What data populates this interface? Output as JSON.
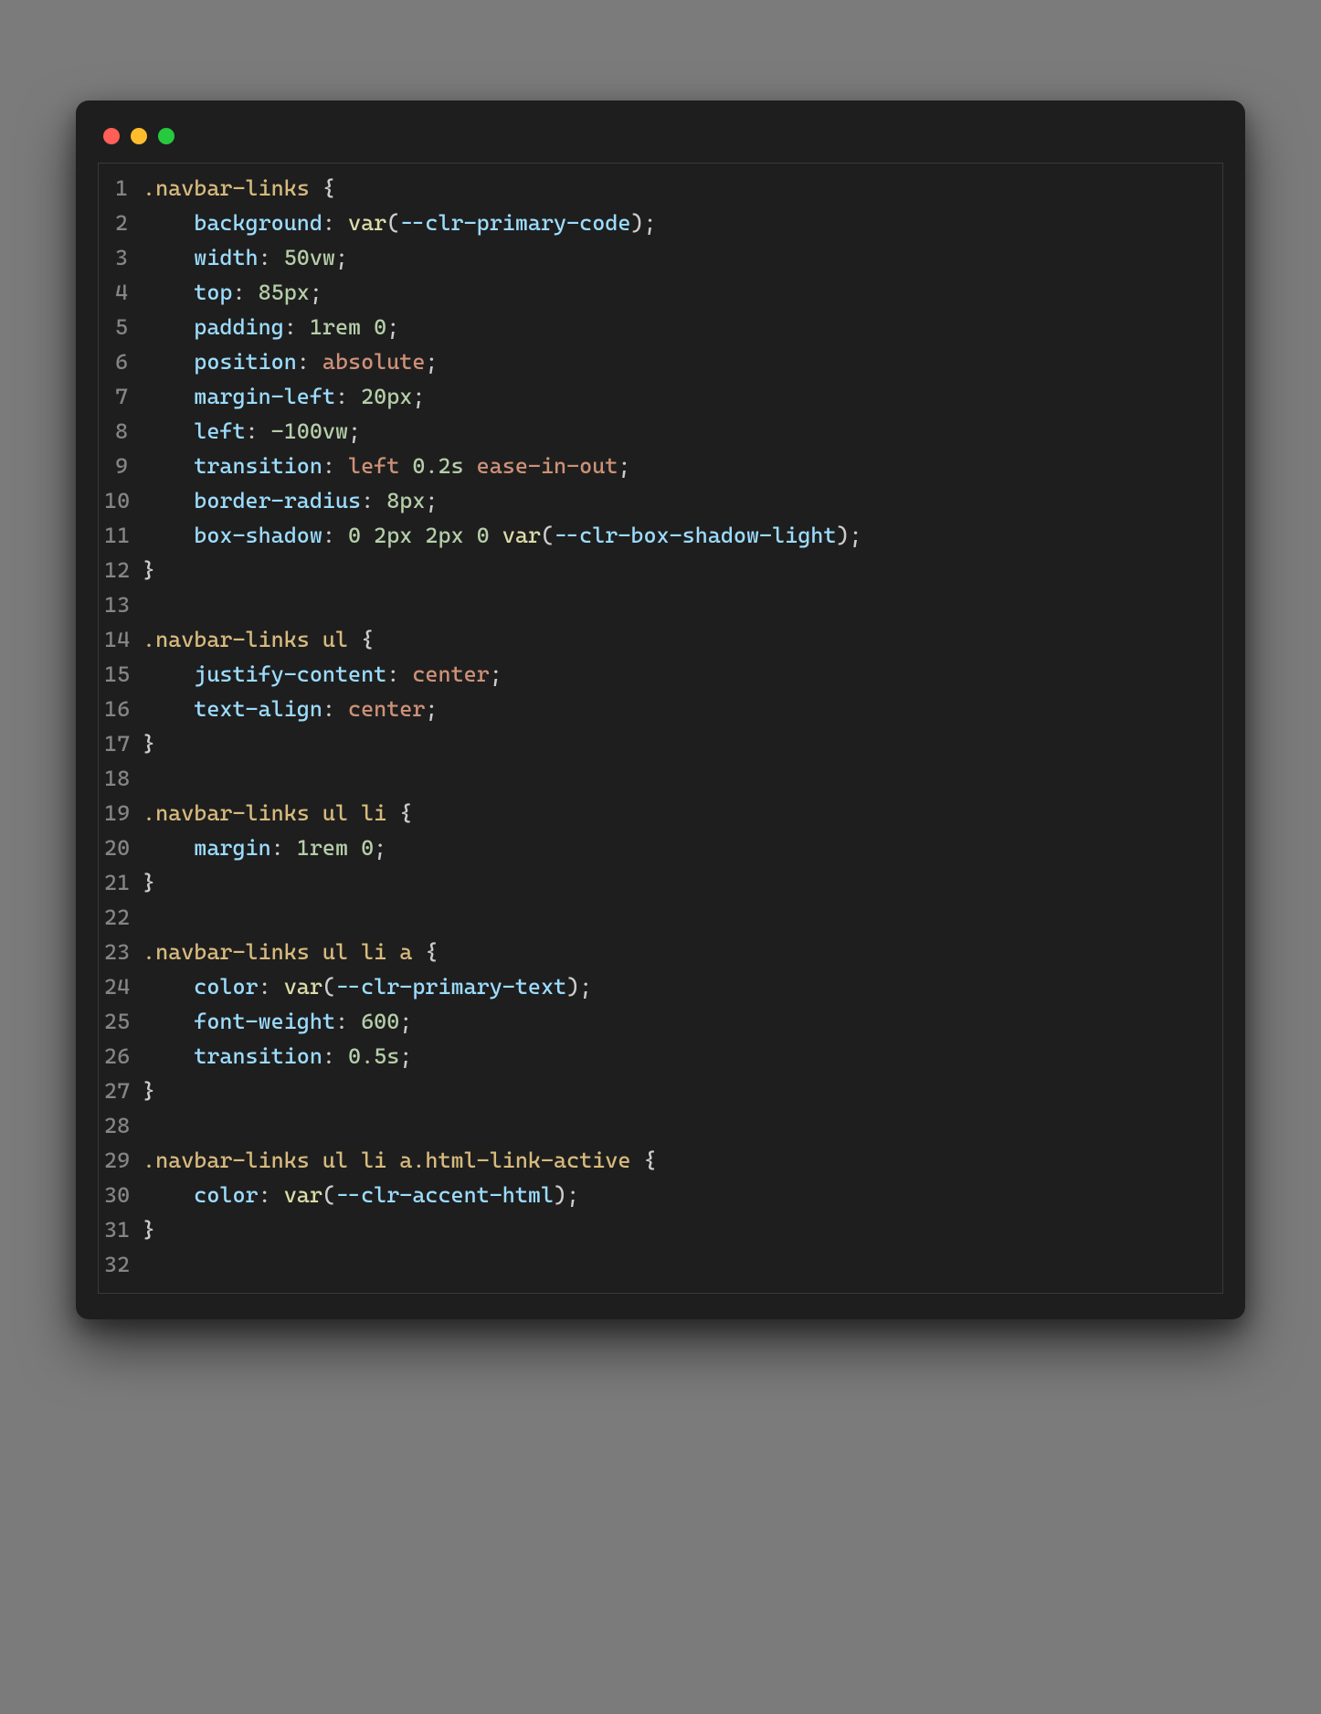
{
  "window": {
    "traffic_lights": [
      "close",
      "minimize",
      "zoom"
    ]
  },
  "code": {
    "language": "css",
    "lines": [
      {
        "n": 1,
        "indent": 0,
        "tokens": [
          {
            "t": ".navbar-links",
            "c": "sel"
          },
          {
            "t": " ",
            "c": "punct"
          },
          {
            "t": "{",
            "c": "brace"
          }
        ]
      },
      {
        "n": 2,
        "indent": 1,
        "tokens": [
          {
            "t": "background",
            "c": "prop"
          },
          {
            "t": ": ",
            "c": "punct"
          },
          {
            "t": "var",
            "c": "func"
          },
          {
            "t": "(",
            "c": "punct"
          },
          {
            "t": "--clr-primary-code",
            "c": "prop"
          },
          {
            "t": ")",
            "c": "punct"
          },
          {
            "t": ";",
            "c": "punct"
          }
        ]
      },
      {
        "n": 3,
        "indent": 1,
        "tokens": [
          {
            "t": "width",
            "c": "prop"
          },
          {
            "t": ": ",
            "c": "punct"
          },
          {
            "t": "50vw",
            "c": "num"
          },
          {
            "t": ";",
            "c": "punct"
          }
        ]
      },
      {
        "n": 4,
        "indent": 1,
        "tokens": [
          {
            "t": "top",
            "c": "prop"
          },
          {
            "t": ": ",
            "c": "punct"
          },
          {
            "t": "85px",
            "c": "num"
          },
          {
            "t": ";",
            "c": "punct"
          }
        ]
      },
      {
        "n": 5,
        "indent": 1,
        "tokens": [
          {
            "t": "padding",
            "c": "prop"
          },
          {
            "t": ": ",
            "c": "punct"
          },
          {
            "t": "1rem",
            "c": "num"
          },
          {
            "t": " ",
            "c": "punct"
          },
          {
            "t": "0",
            "c": "num"
          },
          {
            "t": ";",
            "c": "punct"
          }
        ]
      },
      {
        "n": 6,
        "indent": 1,
        "tokens": [
          {
            "t": "position",
            "c": "prop"
          },
          {
            "t": ": ",
            "c": "punct"
          },
          {
            "t": "absolute",
            "c": "str"
          },
          {
            "t": ";",
            "c": "punct"
          }
        ]
      },
      {
        "n": 7,
        "indent": 1,
        "tokens": [
          {
            "t": "margin-left",
            "c": "prop"
          },
          {
            "t": ": ",
            "c": "punct"
          },
          {
            "t": "20px",
            "c": "num"
          },
          {
            "t": ";",
            "c": "punct"
          }
        ]
      },
      {
        "n": 8,
        "indent": 1,
        "tokens": [
          {
            "t": "left",
            "c": "prop"
          },
          {
            "t": ": ",
            "c": "punct"
          },
          {
            "t": "-100vw",
            "c": "num"
          },
          {
            "t": ";",
            "c": "punct"
          }
        ]
      },
      {
        "n": 9,
        "indent": 1,
        "tokens": [
          {
            "t": "transition",
            "c": "prop"
          },
          {
            "t": ": ",
            "c": "punct"
          },
          {
            "t": "left ",
            "c": "str"
          },
          {
            "t": "0.2s",
            "c": "num"
          },
          {
            "t": " ease-in-out",
            "c": "str"
          },
          {
            "t": ";",
            "c": "punct"
          }
        ]
      },
      {
        "n": 10,
        "indent": 1,
        "tokens": [
          {
            "t": "border-radius",
            "c": "prop"
          },
          {
            "t": ": ",
            "c": "punct"
          },
          {
            "t": "8px",
            "c": "num"
          },
          {
            "t": ";",
            "c": "punct"
          }
        ]
      },
      {
        "n": 11,
        "indent": 1,
        "tokens": [
          {
            "t": "box-shadow",
            "c": "prop"
          },
          {
            "t": ": ",
            "c": "punct"
          },
          {
            "t": "0",
            "c": "num"
          },
          {
            "t": " ",
            "c": "punct"
          },
          {
            "t": "2px",
            "c": "num"
          },
          {
            "t": " ",
            "c": "punct"
          },
          {
            "t": "2px",
            "c": "num"
          },
          {
            "t": " ",
            "c": "punct"
          },
          {
            "t": "0",
            "c": "num"
          },
          {
            "t": " ",
            "c": "punct"
          },
          {
            "t": "var",
            "c": "func"
          },
          {
            "t": "(",
            "c": "punct"
          },
          {
            "t": "--clr-box-shadow-light",
            "c": "prop"
          },
          {
            "t": ")",
            "c": "punct"
          },
          {
            "t": ";",
            "c": "punct"
          }
        ]
      },
      {
        "n": 12,
        "indent": 0,
        "tokens": [
          {
            "t": "}",
            "c": "brace"
          }
        ]
      },
      {
        "n": 13,
        "indent": 0,
        "tokens": []
      },
      {
        "n": 14,
        "indent": 0,
        "tokens": [
          {
            "t": ".navbar-links",
            "c": "sel"
          },
          {
            "t": " ",
            "c": "punct"
          },
          {
            "t": "ul",
            "c": "sel"
          },
          {
            "t": " ",
            "c": "punct"
          },
          {
            "t": "{",
            "c": "brace"
          }
        ]
      },
      {
        "n": 15,
        "indent": 1,
        "tokens": [
          {
            "t": "justify-content",
            "c": "prop"
          },
          {
            "t": ": ",
            "c": "punct"
          },
          {
            "t": "center",
            "c": "str"
          },
          {
            "t": ";",
            "c": "punct"
          }
        ]
      },
      {
        "n": 16,
        "indent": 1,
        "tokens": [
          {
            "t": "text-align",
            "c": "prop"
          },
          {
            "t": ": ",
            "c": "punct"
          },
          {
            "t": "center",
            "c": "str"
          },
          {
            "t": ";",
            "c": "punct"
          }
        ]
      },
      {
        "n": 17,
        "indent": 0,
        "tokens": [
          {
            "t": "}",
            "c": "brace"
          }
        ]
      },
      {
        "n": 18,
        "indent": 0,
        "tokens": []
      },
      {
        "n": 19,
        "indent": 0,
        "tokens": [
          {
            "t": ".navbar-links",
            "c": "sel"
          },
          {
            "t": " ",
            "c": "punct"
          },
          {
            "t": "ul",
            "c": "sel"
          },
          {
            "t": " ",
            "c": "punct"
          },
          {
            "t": "li",
            "c": "sel"
          },
          {
            "t": " ",
            "c": "punct"
          },
          {
            "t": "{",
            "c": "brace"
          }
        ]
      },
      {
        "n": 20,
        "indent": 1,
        "tokens": [
          {
            "t": "margin",
            "c": "prop"
          },
          {
            "t": ": ",
            "c": "punct"
          },
          {
            "t": "1rem",
            "c": "num"
          },
          {
            "t": " ",
            "c": "punct"
          },
          {
            "t": "0",
            "c": "num"
          },
          {
            "t": ";",
            "c": "punct"
          }
        ]
      },
      {
        "n": 21,
        "indent": 0,
        "tokens": [
          {
            "t": "}",
            "c": "brace"
          }
        ]
      },
      {
        "n": 22,
        "indent": 0,
        "tokens": []
      },
      {
        "n": 23,
        "indent": 0,
        "tokens": [
          {
            "t": ".navbar-links",
            "c": "sel"
          },
          {
            "t": " ",
            "c": "punct"
          },
          {
            "t": "ul",
            "c": "sel"
          },
          {
            "t": " ",
            "c": "punct"
          },
          {
            "t": "li",
            "c": "sel"
          },
          {
            "t": " ",
            "c": "punct"
          },
          {
            "t": "a",
            "c": "sel"
          },
          {
            "t": " ",
            "c": "punct"
          },
          {
            "t": "{",
            "c": "brace"
          }
        ]
      },
      {
        "n": 24,
        "indent": 1,
        "tokens": [
          {
            "t": "color",
            "c": "prop"
          },
          {
            "t": ": ",
            "c": "punct"
          },
          {
            "t": "var",
            "c": "func"
          },
          {
            "t": "(",
            "c": "punct"
          },
          {
            "t": "--clr-primary-text",
            "c": "prop"
          },
          {
            "t": ")",
            "c": "punct"
          },
          {
            "t": ";",
            "c": "punct"
          }
        ]
      },
      {
        "n": 25,
        "indent": 1,
        "tokens": [
          {
            "t": "font-weight",
            "c": "prop"
          },
          {
            "t": ": ",
            "c": "punct"
          },
          {
            "t": "600",
            "c": "num"
          },
          {
            "t": ";",
            "c": "punct"
          }
        ]
      },
      {
        "n": 26,
        "indent": 1,
        "tokens": [
          {
            "t": "transition",
            "c": "prop"
          },
          {
            "t": ": ",
            "c": "punct"
          },
          {
            "t": "0.5s",
            "c": "num"
          },
          {
            "t": ";",
            "c": "punct"
          }
        ]
      },
      {
        "n": 27,
        "indent": 0,
        "tokens": [
          {
            "t": "}",
            "c": "brace"
          }
        ]
      },
      {
        "n": 28,
        "indent": 0,
        "tokens": []
      },
      {
        "n": 29,
        "indent": 0,
        "tokens": [
          {
            "t": ".navbar-links",
            "c": "sel"
          },
          {
            "t": " ",
            "c": "punct"
          },
          {
            "t": "ul",
            "c": "sel"
          },
          {
            "t": " ",
            "c": "punct"
          },
          {
            "t": "li",
            "c": "sel"
          },
          {
            "t": " ",
            "c": "punct"
          },
          {
            "t": "a.html-link-active",
            "c": "sel"
          },
          {
            "t": " ",
            "c": "punct"
          },
          {
            "t": "{",
            "c": "brace"
          }
        ]
      },
      {
        "n": 30,
        "indent": 1,
        "tokens": [
          {
            "t": "color",
            "c": "prop"
          },
          {
            "t": ": ",
            "c": "punct"
          },
          {
            "t": "var",
            "c": "func"
          },
          {
            "t": "(",
            "c": "punct"
          },
          {
            "t": "--clr-accent-html",
            "c": "prop"
          },
          {
            "t": ")",
            "c": "punct"
          },
          {
            "t": ";",
            "c": "punct"
          }
        ]
      },
      {
        "n": 31,
        "indent": 0,
        "tokens": [
          {
            "t": "}",
            "c": "brace"
          }
        ]
      },
      {
        "n": 32,
        "indent": 0,
        "tokens": []
      }
    ]
  }
}
